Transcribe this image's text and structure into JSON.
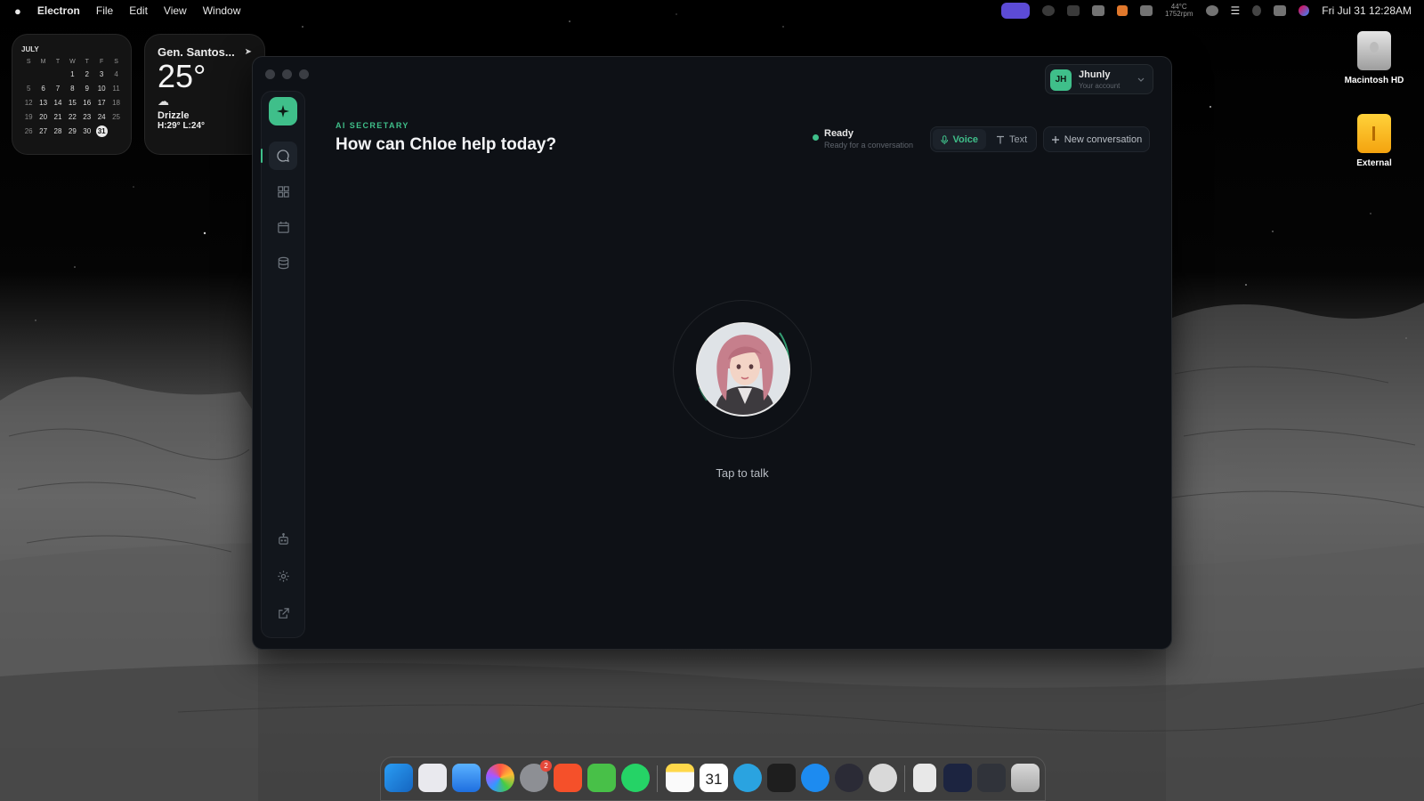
{
  "menubar": {
    "app_name": "Electron",
    "menus": [
      "File",
      "Edit",
      "View",
      "Window"
    ],
    "datetime": "Fri Jul 31  12:28AM",
    "temp_readout": "44°C",
    "fan_readout": "1752rpm"
  },
  "calendar_widget": {
    "month": "JULY",
    "weekdays": [
      "S",
      "M",
      "T",
      "W",
      "T",
      "F",
      "S"
    ],
    "weeks": [
      [
        "",
        "",
        "",
        "1",
        "2",
        "3",
        "4"
      ],
      [
        "5",
        "6",
        "7",
        "8",
        "9",
        "10",
        "11"
      ],
      [
        "12",
        "13",
        "14",
        "15",
        "16",
        "17",
        "18"
      ],
      [
        "19",
        "20",
        "21",
        "22",
        "23",
        "24",
        "25"
      ],
      [
        "26",
        "27",
        "28",
        "29",
        "30",
        "31",
        ""
      ]
    ],
    "today": "31"
  },
  "weather_widget": {
    "city": "Gen. Santos...",
    "temperature": "25°",
    "condition": "Drizzle",
    "high_low": "H:29° L:24°"
  },
  "desktop_icons": [
    {
      "label": "Macintosh HD",
      "icon": "internal-drive-icon"
    },
    {
      "label": "External",
      "icon": "external-drive-icon"
    }
  ],
  "window": {
    "account": {
      "initials": "JH",
      "name": "Jhunly",
      "subtitle": "Your account"
    },
    "eyebrow": "AI SECRETARY",
    "headline": "How can Chloe help today?",
    "status": {
      "title": "Ready",
      "subtitle": "Ready for a conversation"
    },
    "modes": {
      "voice": "Voice",
      "text": "Text",
      "selected": "voice"
    },
    "new_conversation": "New conversation",
    "tap_to_talk": "Tap to talk",
    "sidebar_icons": [
      "chat-icon",
      "grid-icon",
      "calendar-icon",
      "database-icon",
      "bot-icon",
      "settings-icon",
      "external-link-icon"
    ],
    "colors": {
      "accent": "#3fbf8a",
      "background": "#0e1116"
    }
  },
  "dock": {
    "apps": [
      "finder-icon",
      "launchpad-icon",
      "mail-icon",
      "photos-icon",
      "system-settings-icon",
      "brave-icon",
      "streaks-icon",
      "whatsapp-icon",
      "notes-icon",
      "calendar-icon",
      "telegram-icon",
      "figma-icon",
      "proxyman-icon",
      "obs-icon",
      "chatgpt-icon",
      "document-icon",
      "screenshot-icon",
      "app-windows-icon",
      "trash-icon"
    ],
    "system_settings_badge": "2",
    "calendar_day": "31"
  }
}
